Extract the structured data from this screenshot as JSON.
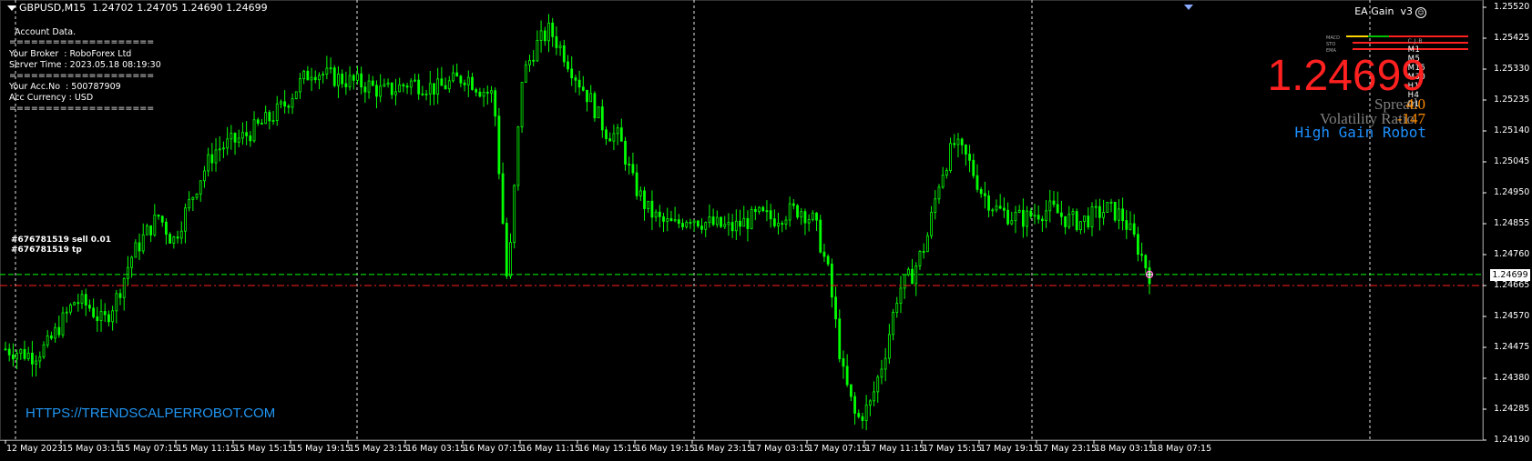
{
  "window": {
    "symbol_header": "GBPUSD,M15  1.24702 1.24705 1.24690 1.24699"
  },
  "account_panel": {
    "lines": [
      "  Account Data.",
      "====================",
      "Your Broker  : RoboForex Ltd",
      "Server Time : 2023.05.18 08:19:30",
      "====================",
      "Your Acc.No  : 500787909",
      "Acc Currency : USD",
      "===================="
    ]
  },
  "ea": {
    "name": "EA Gain  v3",
    "timeframes": [
      "M1",
      "M5",
      "M15",
      "M30",
      "H1",
      "H4",
      "D1"
    ],
    "row_labels": [
      "C.J.B",
      "MACD",
      "STO",
      "EMA"
    ],
    "price": "1.24699",
    "spread_label": "Spread",
    "spread_value": "4.0",
    "volatility_label": "Volatility Ratio",
    "volatility_value": "-147",
    "robot_name": "High Gain Robot",
    "colors": {
      "price": "#ff2020",
      "value": "#ff8c00",
      "label": "#808080",
      "robot": "#1e90ff"
    }
  },
  "watermark_url": "HTTPS://TRENDSCALPERROBOT.COM",
  "orders": [
    {
      "label": "#676781519 sell 0.01",
      "price": 1.24699,
      "color": "#00ff00",
      "style": "dashed"
    },
    {
      "label": "#676781519 tp",
      "price": 1.24665,
      "color": "#ff2020",
      "style": "dashdot"
    }
  ],
  "price_axis": {
    "labels": [
      "1.25520",
      "1.25425",
      "1.25330",
      "1.25235",
      "1.25140",
      "1.25045",
      "1.24950",
      "1.24855",
      "1.24760",
      "1.24665",
      "1.24570",
      "1.24475",
      "1.24380",
      "1.24285",
      "1.24190"
    ],
    "current_price": "1.24699"
  },
  "time_axis": {
    "labels": [
      "12 May 2023",
      "15 May 03:15",
      "15 May 07:15",
      "15 May 11:15",
      "15 May 15:15",
      "15 May 19:15",
      "15 May 23:15",
      "16 May 03:15",
      "16 May 07:15",
      "16 May 11:15",
      "16 May 15:15",
      "16 May 19:15",
      "16 May 23:15",
      "17 May 03:15",
      "17 May 07:15",
      "17 May 11:15",
      "17 May 15:15",
      "17 May 19:15",
      "17 May 23:15",
      "18 May 03:15",
      "18 May 07:15"
    ]
  },
  "chart_data": {
    "type": "candlestick",
    "symbol": "GBPUSD",
    "timeframe": "M15",
    "ylim": [
      1.2419,
      1.2552
    ],
    "bar_color": "#00ff00",
    "close_path": [
      1.2447,
      1.2446,
      1.2445,
      1.2448,
      1.2455,
      1.2462,
      1.246,
      1.2455,
      1.2463,
      1.2475,
      1.2482,
      1.2488,
      1.248,
      1.249,
      1.25,
      1.2508,
      1.251,
      1.2512,
      1.2515,
      1.2518,
      1.2522,
      1.2528,
      1.2533,
      1.2531,
      1.253,
      1.2529,
      1.2528,
      1.2526,
      1.2527,
      1.2529,
      1.2528,
      1.2527,
      1.2529,
      1.2531,
      1.2527,
      1.2525,
      1.2465,
      1.253,
      1.254,
      1.2545,
      1.2538,
      1.253,
      1.2523,
      1.2514,
      1.2512,
      1.2498,
      1.249,
      1.2486,
      1.2485,
      1.2488,
      1.2486,
      1.2485,
      1.2484,
      1.2486,
      1.2488,
      1.2487,
      1.2489,
      1.249,
      1.2486,
      1.247,
      1.244,
      1.2425,
      1.243,
      1.2445,
      1.2465,
      1.247,
      1.248,
      1.25,
      1.251,
      1.2505,
      1.2495,
      1.249,
      1.2488,
      1.2487,
      1.2489,
      1.249,
      1.2487,
      1.2486,
      1.2488,
      1.249,
      1.2488,
      1.248,
      1.247
    ],
    "series": [
      {
        "name": "#676781519 sell 0.01",
        "value": 1.24699
      },
      {
        "name": "#676781519 tp",
        "value": 1.24665
      }
    ]
  }
}
